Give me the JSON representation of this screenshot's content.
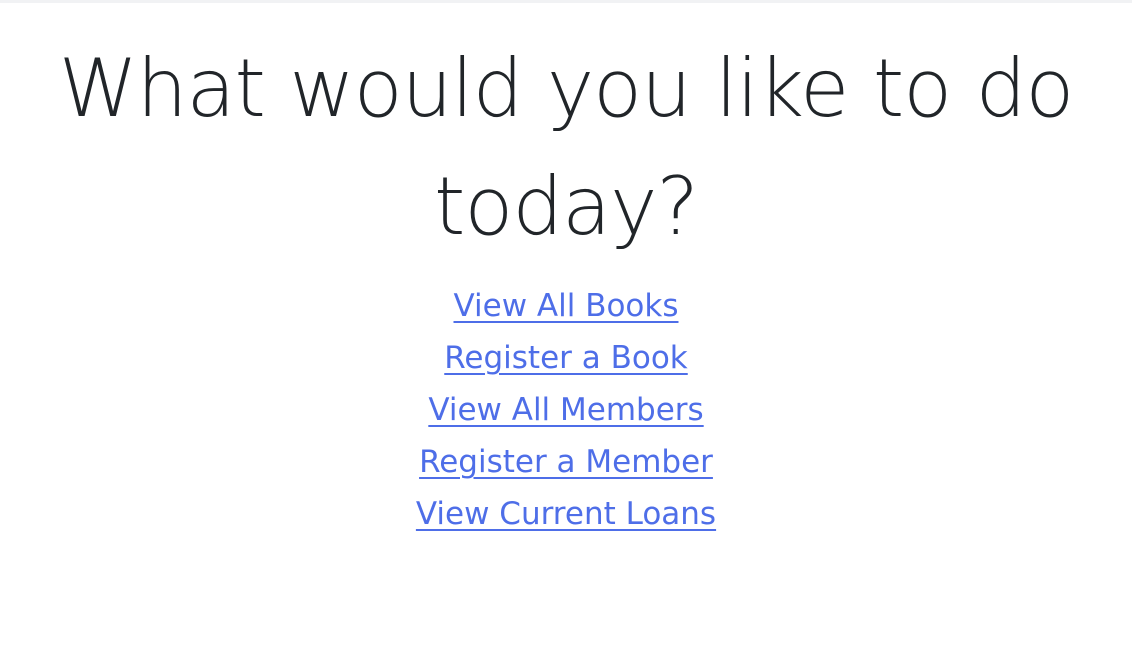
{
  "heading": {
    "text": "What would you like to do today?"
  },
  "links": [
    {
      "label": "View All Books"
    },
    {
      "label": "Register a Book"
    },
    {
      "label": "View All Members"
    },
    {
      "label": "Register a Member"
    },
    {
      "label": "View Current Loans"
    }
  ],
  "colors": {
    "heading_text": "#212529",
    "link_text": "#4e6ee8",
    "background": "#ffffff"
  }
}
